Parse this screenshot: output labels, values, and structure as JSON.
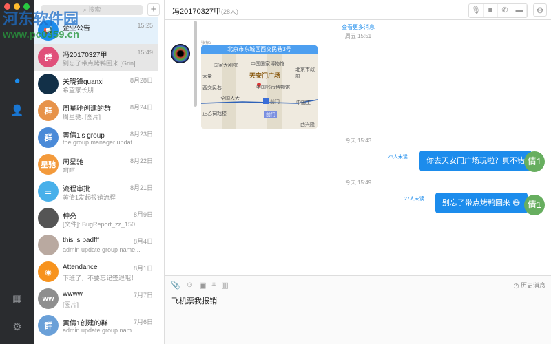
{
  "search": {
    "placeholder": "搜索"
  },
  "sidebar": {
    "icons": [
      "chat-icon",
      "contacts-icon",
      "apps-icon",
      "settings-icon"
    ]
  },
  "conversations": [
    {
      "name": "企业公告",
      "time": "15:25",
      "preview": "",
      "color": "#1c8cec",
      "initials": "📢"
    },
    {
      "name": "冯20170327甲",
      "time": "15:49",
      "preview": "别忘了带点烤鸭回来 [Grin]",
      "color": "#e0507a",
      "initials": "群"
    },
    {
      "name": "关晓锋quanxi",
      "time": "8月28日",
      "preview": "希望家长朋",
      "color": "#123048",
      "initials": ""
    },
    {
      "name": "周星驰创建的群",
      "time": "8月24日",
      "preview": "周星驰: [图片]",
      "color": "#e7934a",
      "initials": "群"
    },
    {
      "name": "黄倩1's group",
      "time": "8月23日",
      "preview": "the group manager updat...",
      "color": "#4a8ad8",
      "initials": "群"
    },
    {
      "name": "周星驰",
      "time": "8月22日",
      "preview": "呵呵",
      "color": "#f39a3b",
      "initials": "星驰"
    },
    {
      "name": "流程审批",
      "time": "8月21日",
      "preview": "黄倩1发起报销流程",
      "color": "#48b0ea",
      "initials": "☰"
    },
    {
      "name": "种亮",
      "time": "8月9日",
      "preview": "[文件]: BugReport_zz_150...",
      "color": "#555",
      "initials": ""
    },
    {
      "name": "this is badfff",
      "time": "8月4日",
      "preview": "admin update group name...",
      "color": "#b9a9a0",
      "initials": ""
    },
    {
      "name": "Attendance",
      "time": "8月1日",
      "preview": "下班了，不要忘记签退哦！",
      "color": "#f7931e",
      "initials": "◉"
    },
    {
      "name": "wwww",
      "time": "7月7日",
      "preview": "[图片]",
      "color": "#8e8e8e",
      "initials": "ww"
    },
    {
      "name": "黄倩1创建的群",
      "time": "7月6日",
      "preview": "admin update group nam...",
      "color": "#6aa0d8",
      "initials": "群"
    }
  ],
  "chat": {
    "title": "冯20170327甲",
    "member_count": "(28人)",
    "more": "查看更多消息",
    "time1": "周五 15:51",
    "sender": "张振3",
    "map": {
      "address": "北京市东城区西交民巷3号",
      "labels": [
        "国家大剧院",
        "中国国家博物馆",
        "天安门广场",
        "西交民巷",
        "中国钱币博物馆",
        "全国人大",
        "前门",
        "中国工",
        "北京市政府",
        "大量",
        "正乙祠戏楼",
        "前门",
        "西兴隆"
      ]
    },
    "time2": "今天 15:43",
    "msg1": "你去天安门广场玩啦？真不错",
    "unread1": "26人未读",
    "time3": "今天 15:49",
    "msg2": "别忘了带点烤鸭回来 😄",
    "unread2": "27人未读",
    "my_avatar": "倩1",
    "input_text": "飞机票我报销",
    "history": "历史消息"
  },
  "watermark": {
    "title": "河东软件园",
    "url": "www.pc0359.cn"
  }
}
